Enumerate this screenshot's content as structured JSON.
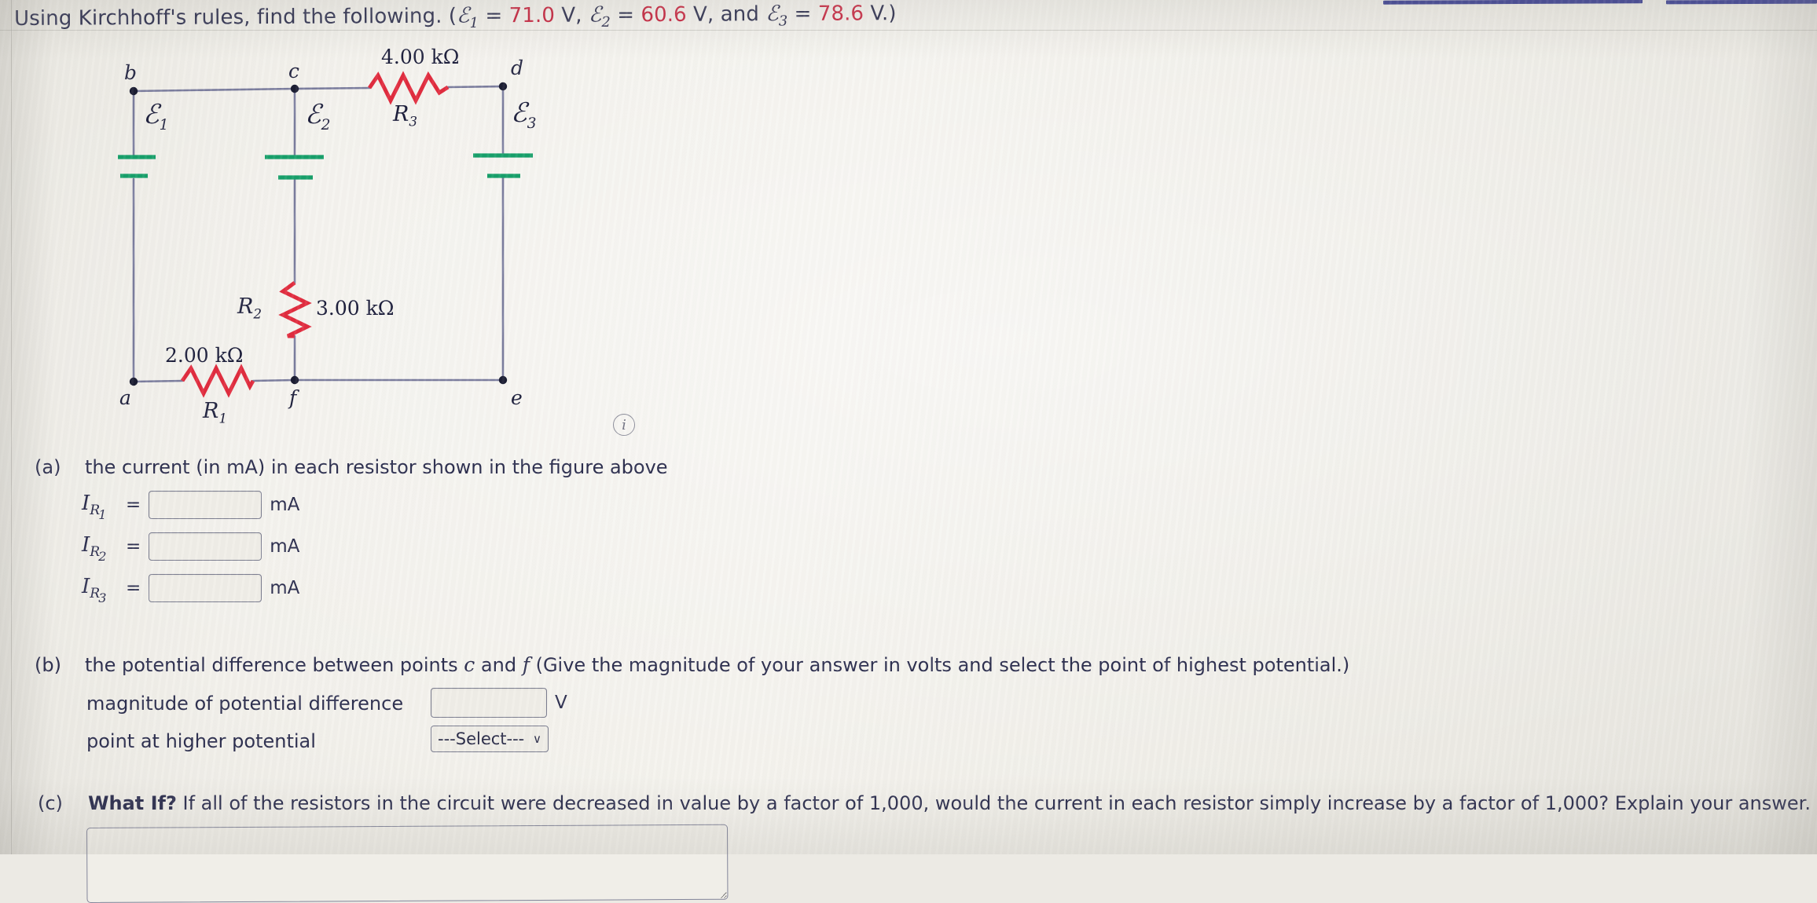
{
  "prompt": {
    "lead": "Using Kirchhoff's rules, find the following. (",
    "e1_sym": "ℰ",
    "e1_sub": "1",
    "e1_eq": " = ",
    "e1_val": "71.0",
    "e1_unit": " V, ",
    "e2_sym": "ℰ",
    "e2_sub": "2",
    "e2_eq": " = ",
    "e2_val": "60.6",
    "e2_unit": " V, and ",
    "e3_sym": "ℰ",
    "e3_sub": "3",
    "e3_eq": " = ",
    "e3_val": "78.6",
    "e3_unit": " V.)",
    "value_color": "#c9243f"
  },
  "figure": {
    "nodes": {
      "a": "a",
      "b": "b",
      "c": "c",
      "d": "d",
      "e": "e",
      "f": "f"
    },
    "emf": {
      "e1": {
        "symbol": "ℰ",
        "sub": "1"
      },
      "e2": {
        "symbol": "ℰ",
        "sub": "2"
      },
      "e3": {
        "symbol": "ℰ",
        "sub": "3"
      }
    },
    "resistors": {
      "r1": {
        "name": "R",
        "sub": "1",
        "value": "2.00 kΩ"
      },
      "r2": {
        "name": "R",
        "sub": "2",
        "value": "3.00 kΩ"
      },
      "r3": {
        "name": "R",
        "sub": "3",
        "value": "4.00 kΩ"
      }
    },
    "colors": {
      "wire": "#7b7d9e",
      "resistor": "#e12d3f",
      "battery": "#17a06a",
      "node": "#1b1d33"
    },
    "info_icon": "i"
  },
  "parts": {
    "a": {
      "tag": "(a)",
      "text": "the current (in mA) in each resistor shown in the figure above",
      "rows": [
        {
          "symbol": "I",
          "sub_r": "R",
          "sub_n": "1",
          "equals": "=",
          "value": "",
          "unit": "mA"
        },
        {
          "symbol": "I",
          "sub_r": "R",
          "sub_n": "2",
          "equals": "=",
          "value": "",
          "unit": "mA"
        },
        {
          "symbol": "I",
          "sub_r": "R",
          "sub_n": "3",
          "equals": "=",
          "value": "",
          "unit": "mA"
        }
      ]
    },
    "b": {
      "tag": "(b)",
      "text_1": "the potential difference between points ",
      "point_c": "c",
      "text_2": " and ",
      "point_f": "f",
      "text_3": " (Give the magnitude of your answer in volts and select the point of highest potential.)",
      "row1_label": "magnitude of potential difference",
      "row1_value": "",
      "row1_unit": "V",
      "row2_label": "point at higher potential",
      "row2_select": "---Select---",
      "row2_chevron": "∨"
    },
    "c": {
      "tag": "(c)",
      "bold_text": "What If?",
      "text": " If all of the resistors in the circuit were decreased in value by a factor of 1,000, would the current in each resistor simply increase by a factor of 1,000? Explain your answer.",
      "answer_value": ""
    }
  }
}
